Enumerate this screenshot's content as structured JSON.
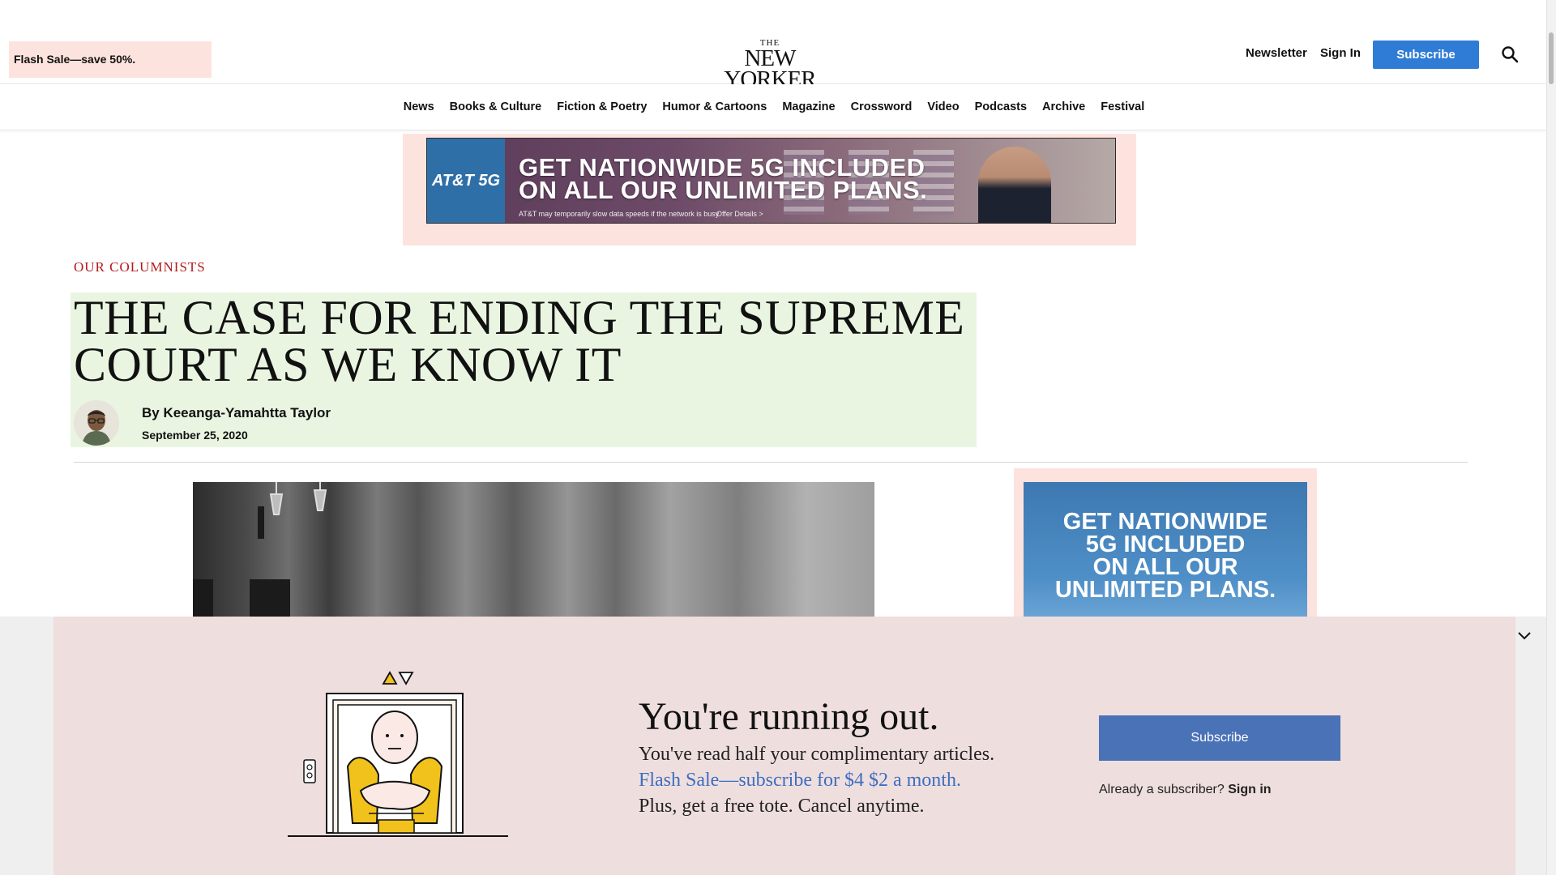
{
  "header": {
    "flash_badge": "Flash Sale—save 50%.",
    "logo_small": "THE",
    "logo_main": "NEW YORKER",
    "newsletter": "Newsletter",
    "sign_in": "Sign In",
    "subscribe": "Subscribe"
  },
  "nav": {
    "items": [
      "News",
      "Books & Culture",
      "Fiction & Poetry",
      "Humor & Cartoons",
      "Magazine",
      "Crossword",
      "Video",
      "Podcasts",
      "Archive",
      "Festival"
    ]
  },
  "top_ad": {
    "brand": "AT&T 5G",
    "headline": "GET NATIONWIDE 5G INCLUDED\nON ALL OUR UNLIMITED PLANS.",
    "fine_print": "AT&T may temporarily slow data speeds if the network is busy",
    "details": "Offer Details >"
  },
  "article": {
    "kicker": "OUR COLUMNISTS",
    "title": "THE CASE FOR ENDING THE SUPREME COURT AS WE KNOW IT",
    "byline": "By Keeanga-Yamahtta Taylor",
    "date": "September 25, 2020"
  },
  "side_ad": {
    "headline": "GET NATIONWIDE\n5G INCLUDED\nON ALL OUR\nUNLIMITED PLANS."
  },
  "paywall": {
    "heading": "You're running out.",
    "line1": "You've read half your complimentary articles.",
    "line2": "Flash Sale—subscribe for $4 $2 a month.",
    "line3": "Plus, get a free tote. Cancel anytime.",
    "subscribe": "Subscribe",
    "already": "Already a subscriber?",
    "sign_in": "Sign in"
  },
  "colors": {
    "accent_blue": "#2f7cd6",
    "kicker_red": "#b3191c",
    "paywall_bg": "#efdede",
    "title_highlight": "#e9f5e1",
    "ad_highlight": "#fde3de"
  }
}
